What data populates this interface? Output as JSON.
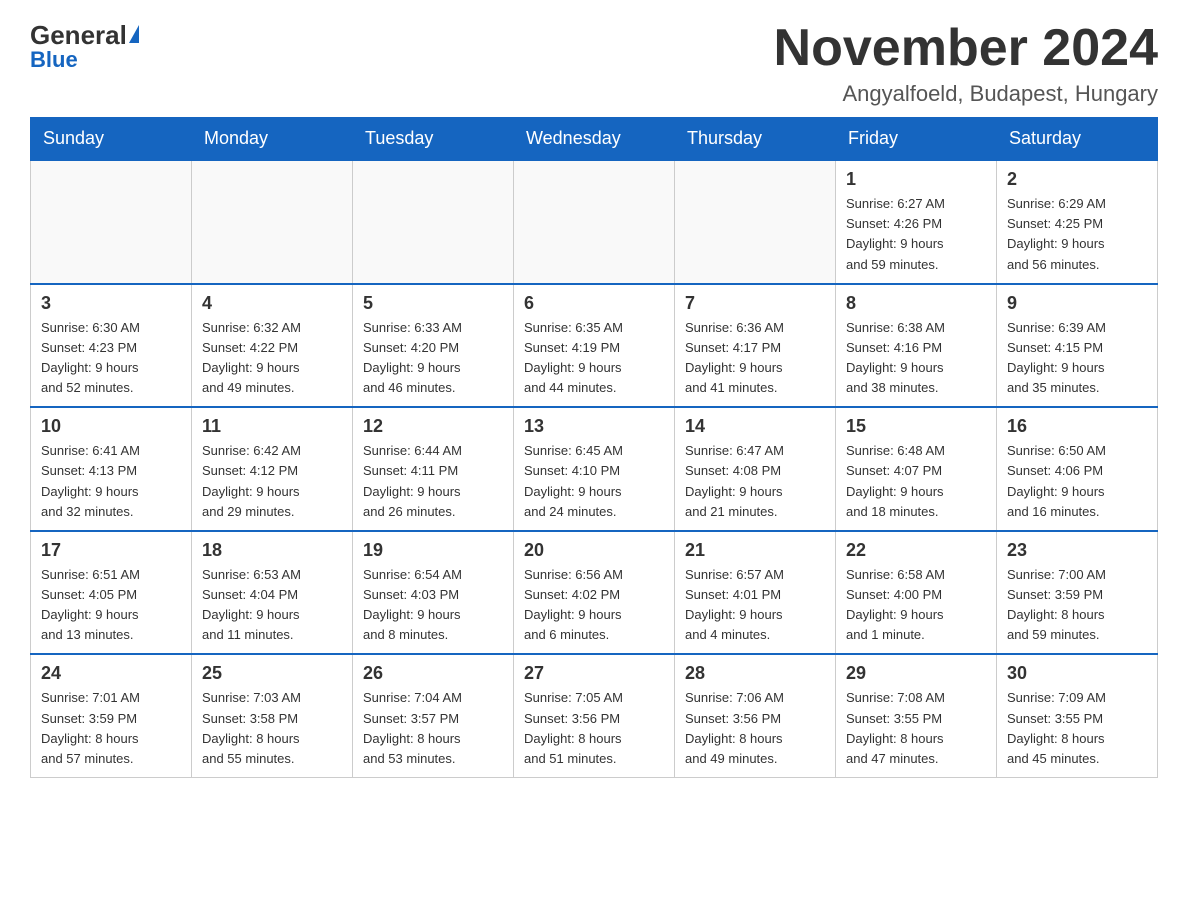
{
  "header": {
    "logo_general": "General",
    "logo_blue": "Blue",
    "month_title": "November 2024",
    "location": "Angyalfoeld, Budapest, Hungary"
  },
  "weekdays": [
    "Sunday",
    "Monday",
    "Tuesday",
    "Wednesday",
    "Thursday",
    "Friday",
    "Saturday"
  ],
  "weeks": [
    [
      {
        "day": "",
        "info": ""
      },
      {
        "day": "",
        "info": ""
      },
      {
        "day": "",
        "info": ""
      },
      {
        "day": "",
        "info": ""
      },
      {
        "day": "",
        "info": ""
      },
      {
        "day": "1",
        "info": "Sunrise: 6:27 AM\nSunset: 4:26 PM\nDaylight: 9 hours\nand 59 minutes."
      },
      {
        "day": "2",
        "info": "Sunrise: 6:29 AM\nSunset: 4:25 PM\nDaylight: 9 hours\nand 56 minutes."
      }
    ],
    [
      {
        "day": "3",
        "info": "Sunrise: 6:30 AM\nSunset: 4:23 PM\nDaylight: 9 hours\nand 52 minutes."
      },
      {
        "day": "4",
        "info": "Sunrise: 6:32 AM\nSunset: 4:22 PM\nDaylight: 9 hours\nand 49 minutes."
      },
      {
        "day": "5",
        "info": "Sunrise: 6:33 AM\nSunset: 4:20 PM\nDaylight: 9 hours\nand 46 minutes."
      },
      {
        "day": "6",
        "info": "Sunrise: 6:35 AM\nSunset: 4:19 PM\nDaylight: 9 hours\nand 44 minutes."
      },
      {
        "day": "7",
        "info": "Sunrise: 6:36 AM\nSunset: 4:17 PM\nDaylight: 9 hours\nand 41 minutes."
      },
      {
        "day": "8",
        "info": "Sunrise: 6:38 AM\nSunset: 4:16 PM\nDaylight: 9 hours\nand 38 minutes."
      },
      {
        "day": "9",
        "info": "Sunrise: 6:39 AM\nSunset: 4:15 PM\nDaylight: 9 hours\nand 35 minutes."
      }
    ],
    [
      {
        "day": "10",
        "info": "Sunrise: 6:41 AM\nSunset: 4:13 PM\nDaylight: 9 hours\nand 32 minutes."
      },
      {
        "day": "11",
        "info": "Sunrise: 6:42 AM\nSunset: 4:12 PM\nDaylight: 9 hours\nand 29 minutes."
      },
      {
        "day": "12",
        "info": "Sunrise: 6:44 AM\nSunset: 4:11 PM\nDaylight: 9 hours\nand 26 minutes."
      },
      {
        "day": "13",
        "info": "Sunrise: 6:45 AM\nSunset: 4:10 PM\nDaylight: 9 hours\nand 24 minutes."
      },
      {
        "day": "14",
        "info": "Sunrise: 6:47 AM\nSunset: 4:08 PM\nDaylight: 9 hours\nand 21 minutes."
      },
      {
        "day": "15",
        "info": "Sunrise: 6:48 AM\nSunset: 4:07 PM\nDaylight: 9 hours\nand 18 minutes."
      },
      {
        "day": "16",
        "info": "Sunrise: 6:50 AM\nSunset: 4:06 PM\nDaylight: 9 hours\nand 16 minutes."
      }
    ],
    [
      {
        "day": "17",
        "info": "Sunrise: 6:51 AM\nSunset: 4:05 PM\nDaylight: 9 hours\nand 13 minutes."
      },
      {
        "day": "18",
        "info": "Sunrise: 6:53 AM\nSunset: 4:04 PM\nDaylight: 9 hours\nand 11 minutes."
      },
      {
        "day": "19",
        "info": "Sunrise: 6:54 AM\nSunset: 4:03 PM\nDaylight: 9 hours\nand 8 minutes."
      },
      {
        "day": "20",
        "info": "Sunrise: 6:56 AM\nSunset: 4:02 PM\nDaylight: 9 hours\nand 6 minutes."
      },
      {
        "day": "21",
        "info": "Sunrise: 6:57 AM\nSunset: 4:01 PM\nDaylight: 9 hours\nand 4 minutes."
      },
      {
        "day": "22",
        "info": "Sunrise: 6:58 AM\nSunset: 4:00 PM\nDaylight: 9 hours\nand 1 minute."
      },
      {
        "day": "23",
        "info": "Sunrise: 7:00 AM\nSunset: 3:59 PM\nDaylight: 8 hours\nand 59 minutes."
      }
    ],
    [
      {
        "day": "24",
        "info": "Sunrise: 7:01 AM\nSunset: 3:59 PM\nDaylight: 8 hours\nand 57 minutes."
      },
      {
        "day": "25",
        "info": "Sunrise: 7:03 AM\nSunset: 3:58 PM\nDaylight: 8 hours\nand 55 minutes."
      },
      {
        "day": "26",
        "info": "Sunrise: 7:04 AM\nSunset: 3:57 PM\nDaylight: 8 hours\nand 53 minutes."
      },
      {
        "day": "27",
        "info": "Sunrise: 7:05 AM\nSunset: 3:56 PM\nDaylight: 8 hours\nand 51 minutes."
      },
      {
        "day": "28",
        "info": "Sunrise: 7:06 AM\nSunset: 3:56 PM\nDaylight: 8 hours\nand 49 minutes."
      },
      {
        "day": "29",
        "info": "Sunrise: 7:08 AM\nSunset: 3:55 PM\nDaylight: 8 hours\nand 47 minutes."
      },
      {
        "day": "30",
        "info": "Sunrise: 7:09 AM\nSunset: 3:55 PM\nDaylight: 8 hours\nand 45 minutes."
      }
    ]
  ]
}
